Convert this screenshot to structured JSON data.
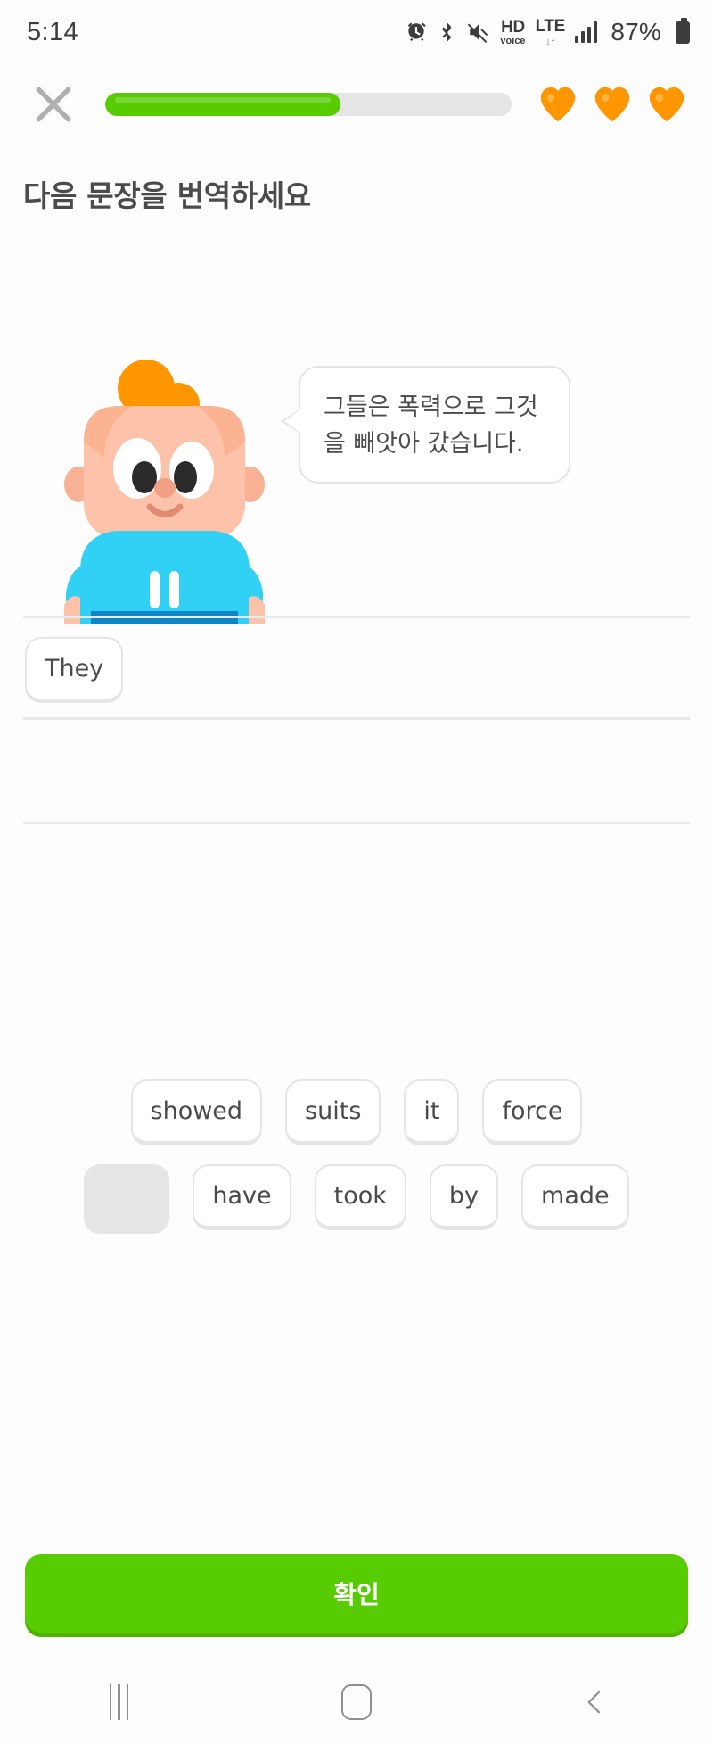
{
  "status_bar": {
    "time": "5:14",
    "battery_percent": "87%",
    "icons": [
      "alarm-icon",
      "bluetooth-icon",
      "mute-icon",
      "hd-voice-icon",
      "lte-icon",
      "signal-icon",
      "battery-icon"
    ],
    "hd_label": "HD",
    "hd_sub_label": "voice",
    "lte_label": "LTE",
    "lte_arrows": "↓↑"
  },
  "header": {
    "close_icon": "close-icon",
    "progress_percent": 58,
    "progress_fill_color": "#58cc02",
    "progress_track_color": "#e5e5e5",
    "hearts_count": 3,
    "heart_color": "#ff9600"
  },
  "lesson": {
    "prompt_title": "다음 문장을 번역하세요",
    "speech_bubble_text": "그들은 폭력으로 그것을 빼앗아 갔습니다.",
    "character": "duolingo-junior-character"
  },
  "answer": {
    "line_count": 3,
    "placed_words": [
      "They"
    ]
  },
  "word_bank": {
    "rows": [
      {
        "tiles": [
          {
            "label": "showed",
            "used": false
          },
          {
            "label": "suits",
            "used": false
          },
          {
            "label": "it",
            "used": false
          },
          {
            "label": "force",
            "used": false
          }
        ]
      },
      {
        "tiles": [
          {
            "label": "They",
            "used": true
          },
          {
            "label": "have",
            "used": false
          },
          {
            "label": "took",
            "used": false
          },
          {
            "label": "by",
            "used": false
          },
          {
            "label": "made",
            "used": false
          }
        ]
      }
    ]
  },
  "footer": {
    "check_label": "확인",
    "check_color": "#58cc02"
  },
  "nav_bar": {
    "recents_label": "recents-icon",
    "home_label": "home-icon",
    "back_label": "back-icon"
  }
}
